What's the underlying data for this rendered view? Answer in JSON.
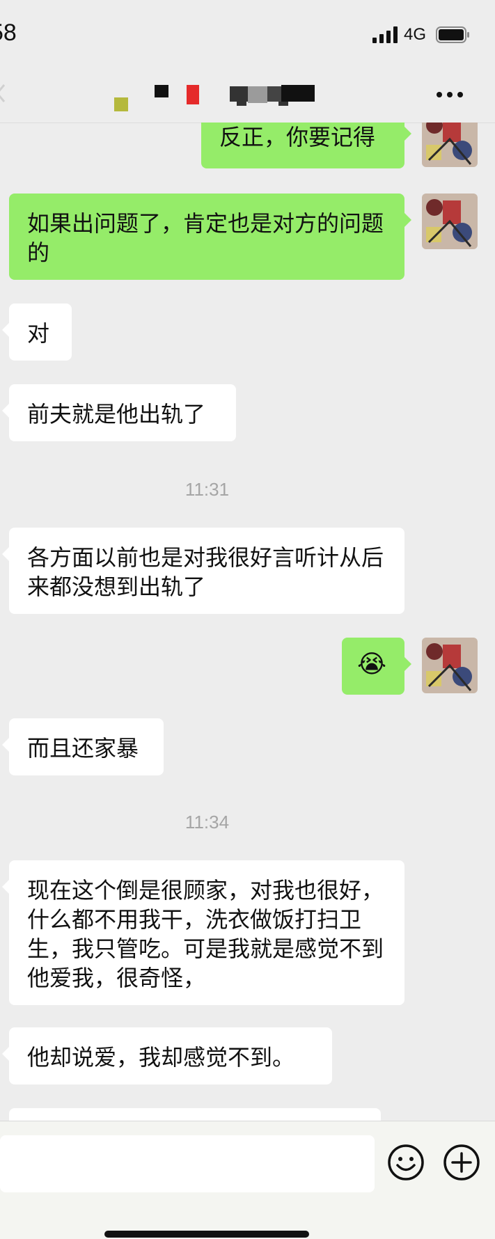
{
  "status_bar": {
    "time": "58",
    "network": "4G"
  },
  "nav": {
    "more_icon": "more-dots-icon"
  },
  "messages": [
    {
      "side": "out",
      "text": "反正，你要记得"
    },
    {
      "side": "out",
      "text": "如果出问题了，肯定也是对方的问题的"
    },
    {
      "side": "in",
      "text": "对"
    },
    {
      "side": "in",
      "text": "前夫就是他出轨了"
    },
    {
      "type": "time",
      "text": "11:31"
    },
    {
      "side": "in",
      "text": "各方面以前也是对我很好言听计从后来都没想到出轨了"
    },
    {
      "side": "out",
      "emoji": "😭"
    },
    {
      "side": "in",
      "text": "而且还家暴"
    },
    {
      "type": "time",
      "text": "11:34"
    },
    {
      "side": "in",
      "text": "现在这个倒是很顾家，对我也很好，什么都不用我干，洗衣做饭打扫卫生，我只管吃。可是我就是感觉不到他爱我，很奇怪，"
    },
    {
      "side": "in",
      "text": "他却说爱，我却感觉不到。"
    }
  ],
  "input_bar": {
    "placeholder": "",
    "emoji_icon": "emoji-icon",
    "plus_icon": "plus-icon"
  },
  "colors": {
    "outgoing_bubble": "#95ec69",
    "incoming_bubble": "#ffffff",
    "chat_bg": "#ededed"
  }
}
